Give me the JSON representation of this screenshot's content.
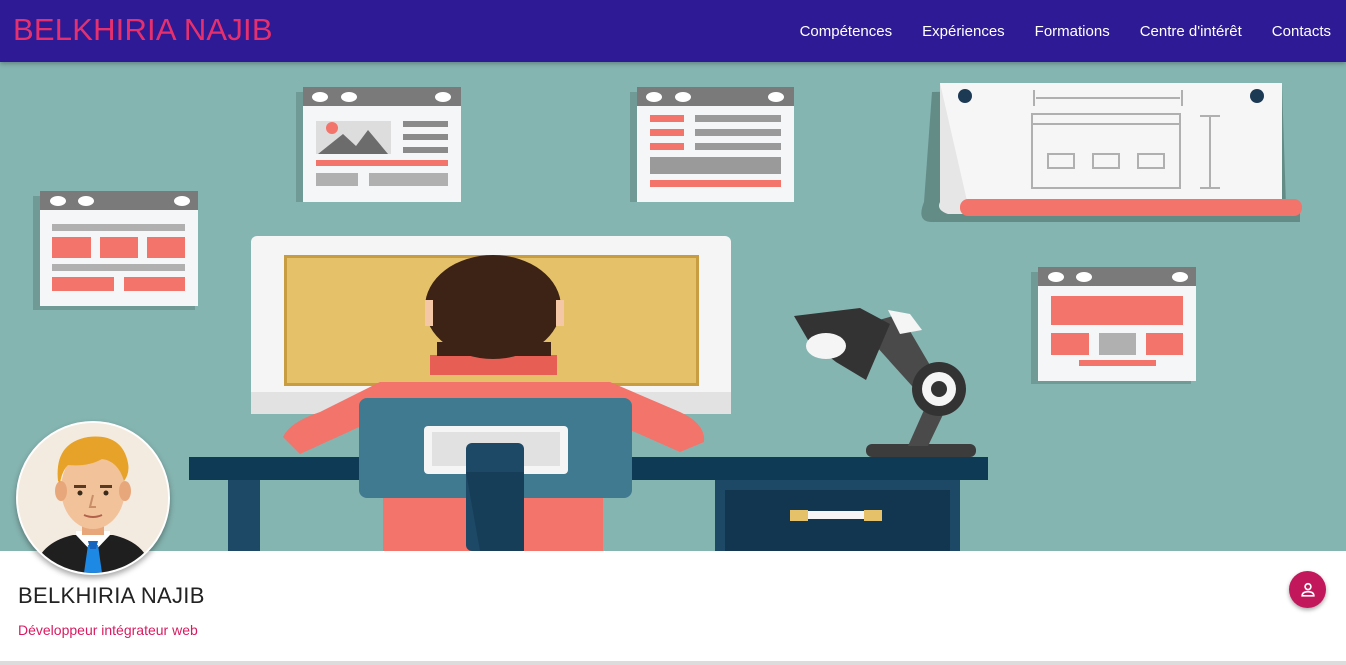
{
  "navbar": {
    "brand": "BELKHIRIA NAJIB",
    "links": [
      "Compétences",
      "Expériences",
      "Formations",
      "Centre d'intérêt",
      "Contacts"
    ]
  },
  "hero": {
    "illustration": "developer-at-desk-illustration",
    "background_color": "#85b5b1"
  },
  "profile": {
    "name": "BELKHIRIA NAJIB",
    "title": "Développeur intégrateur web",
    "avatar_icon": "cartoon-man-avatar",
    "contact_button_icon": "person-icon"
  },
  "colors": {
    "navbar": "#2e1a94",
    "brand": "#e6306e",
    "accent": "#c2185b"
  }
}
